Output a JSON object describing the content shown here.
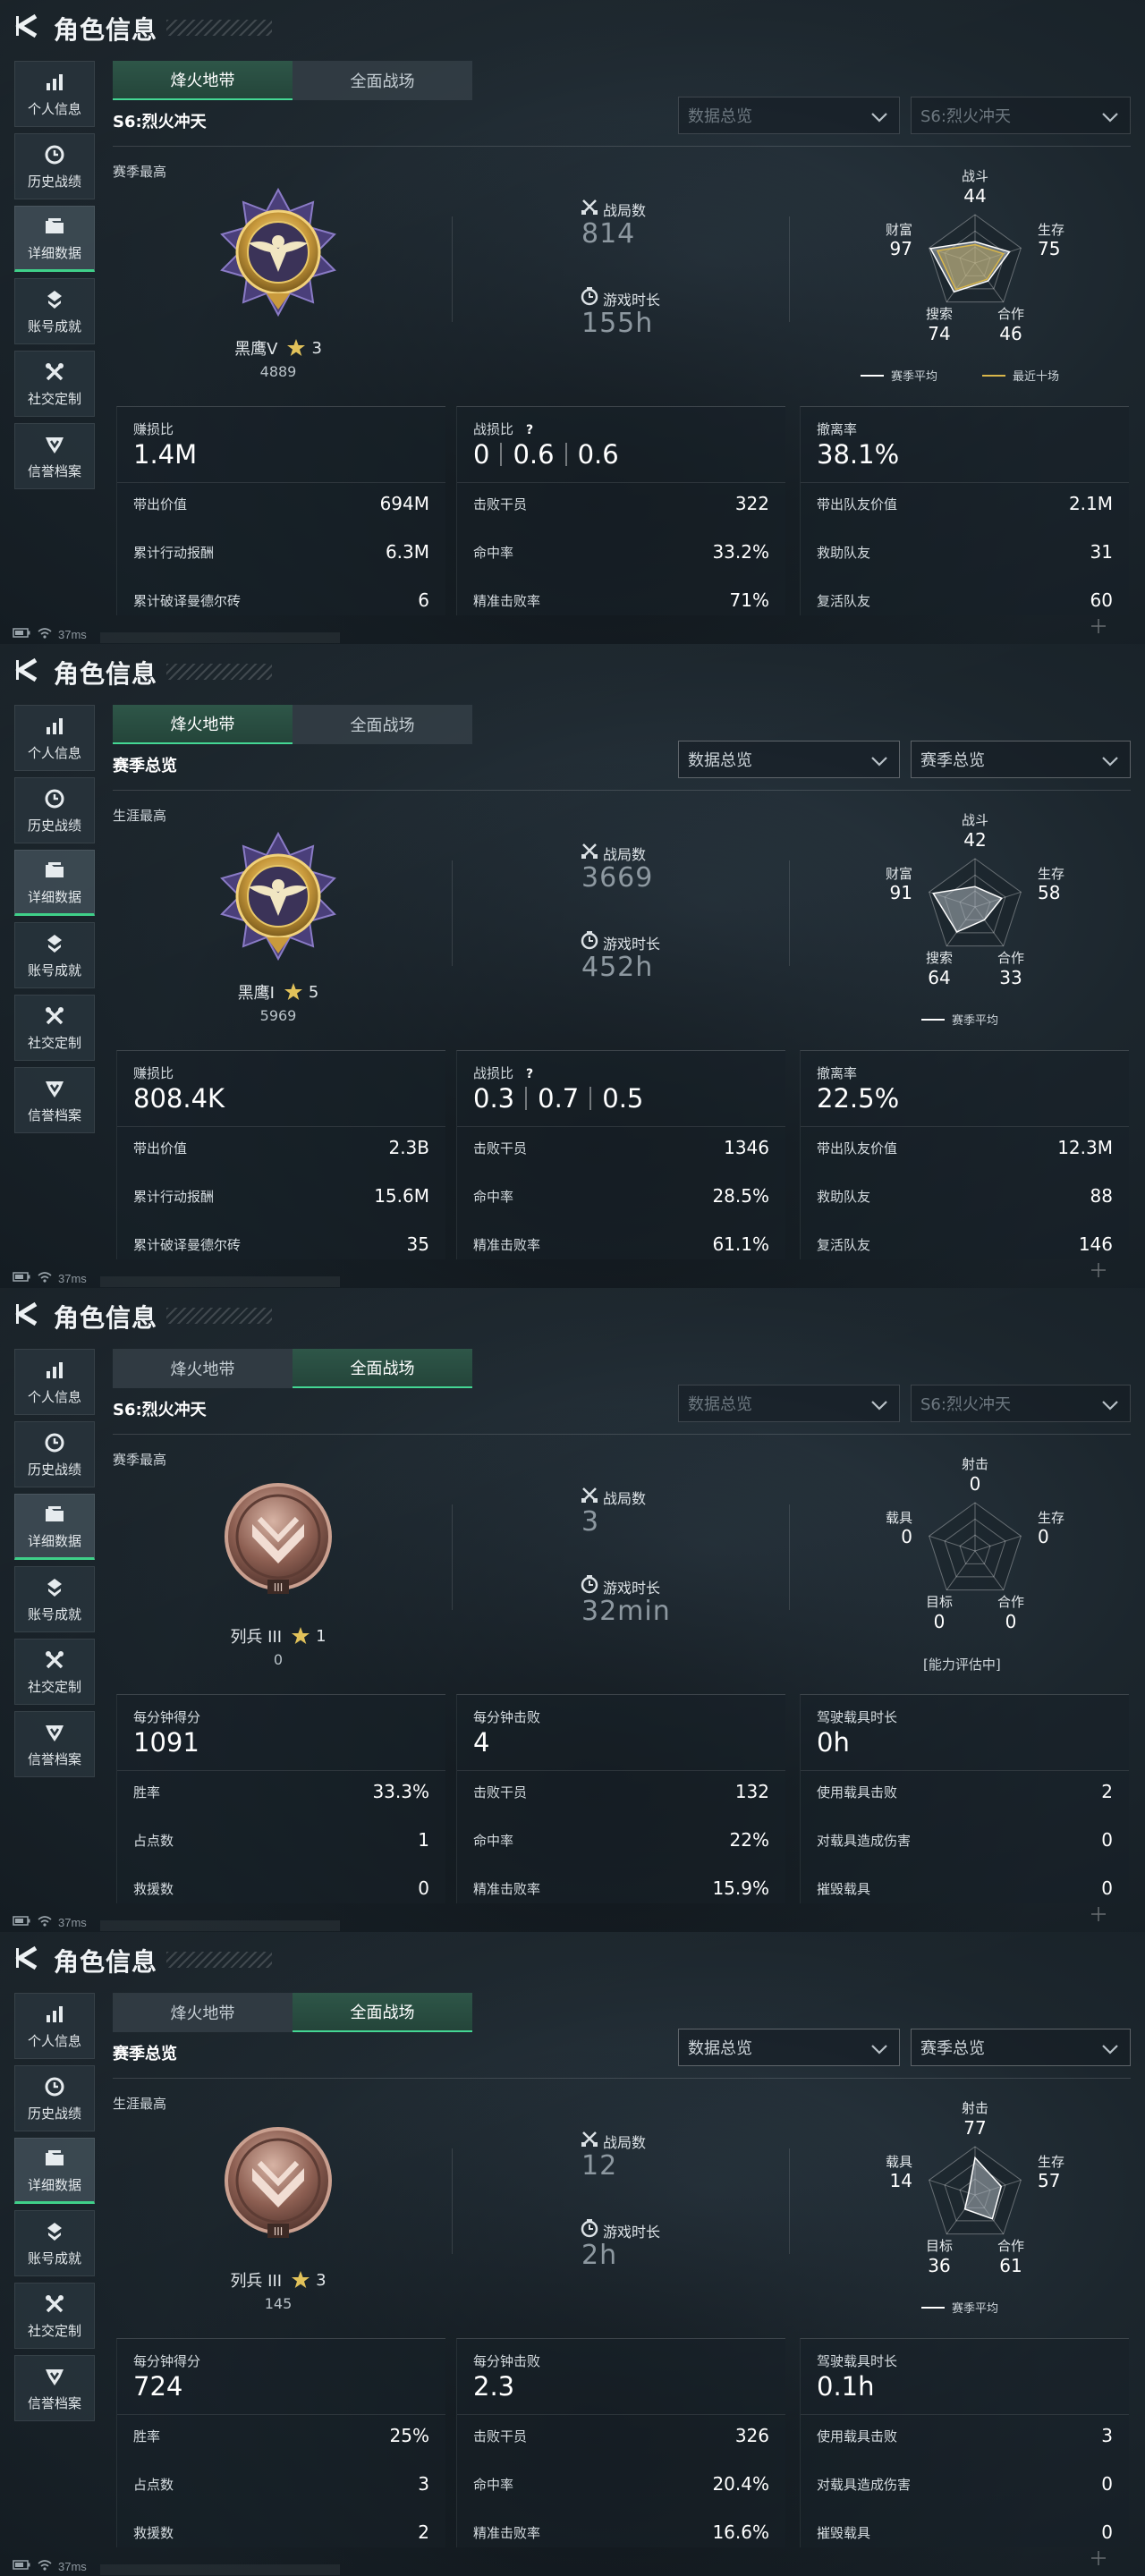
{
  "colors": {
    "accent_green": "#3fd089",
    "season_avg_line": "#ffffff",
    "recent_ten_line": "#d9b64a"
  },
  "panels": [
    {
      "title": "角色信息",
      "sidebar": [
        {
          "label": "个人信息",
          "icon": "bar-chart-icon"
        },
        {
          "label": "历史战绩",
          "icon": "clock-icon"
        },
        {
          "label": "详细数据",
          "icon": "folder-icon",
          "active": true
        },
        {
          "label": "账号成就",
          "icon": "achievement-icon"
        },
        {
          "label": "社交定制",
          "icon": "tools-icon"
        },
        {
          "label": "信誉档案",
          "icon": "shield-icon"
        }
      ],
      "tabs": [
        {
          "label": "烽火地带",
          "active": true
        },
        {
          "label": "全面战场",
          "active": false
        }
      ],
      "season_title": "S6:烈火冲天",
      "dropdown1": "数据总览",
      "dropdown2": "S6:烈火冲天",
      "dropdowns_dim": true,
      "best_label": "赛季最高",
      "rank": {
        "name": "黑鹰V",
        "stars": "3",
        "score": "4889",
        "badge": "eagle-badge"
      },
      "matches_label": "战局数",
      "matches": "814",
      "time_label": "游戏时长",
      "time": "155h",
      "radar": {
        "labels": [
          "战斗",
          "生存",
          "合作",
          "搜索",
          "财富"
        ],
        "values": [
          "44",
          "75",
          "46",
          "74",
          "97"
        ],
        "season_avg": [
          0.44,
          0.75,
          0.46,
          0.74,
          0.97
        ],
        "recent_ten": [
          0.38,
          0.62,
          0.42,
          0.68,
          0.82
        ],
        "legend": [
          "赛季平均",
          "最近十场"
        ],
        "unknown": false
      },
      "cards": [
        {
          "head_label": "赚损比",
          "head_value": "1.4M",
          "rows": [
            {
              "label": "带出价值",
              "value": "694M"
            },
            {
              "label": "累计行动报酬",
              "value": "6.3M"
            },
            {
              "label": "累计破译曼德尔砖",
              "value": "6"
            }
          ]
        },
        {
          "head_label": "战损比",
          "ratios": [
            "0",
            "0.6",
            "0.6"
          ],
          "rows": [
            {
              "label": "击败干员",
              "value": "322"
            },
            {
              "label": "命中率",
              "value": "33.2%"
            },
            {
              "label": "精准击败率",
              "value": "71%"
            }
          ]
        },
        {
          "head_label": "撤离率",
          "head_value": "38.1%",
          "rows": [
            {
              "label": "带出队友价值",
              "value": "2.1M"
            },
            {
              "label": "救助队友",
              "value": "31"
            },
            {
              "label": "复活队友",
              "value": "60"
            }
          ]
        }
      ],
      "status_ping": "37ms"
    },
    {
      "title": "角色信息",
      "sidebar": [
        {
          "label": "个人信息",
          "icon": "bar-chart-icon"
        },
        {
          "label": "历史战绩",
          "icon": "clock-icon"
        },
        {
          "label": "详细数据",
          "icon": "folder-icon",
          "active": true
        },
        {
          "label": "账号成就",
          "icon": "achievement-icon"
        },
        {
          "label": "社交定制",
          "icon": "tools-icon"
        },
        {
          "label": "信誉档案",
          "icon": "shield-icon"
        }
      ],
      "tabs": [
        {
          "label": "烽火地带",
          "active": true
        },
        {
          "label": "全面战场",
          "active": false
        }
      ],
      "season_title": "赛季总览",
      "dropdown1": "数据总览",
      "dropdown2": "赛季总览",
      "dropdowns_dim": false,
      "best_label": "生涯最高",
      "rank": {
        "name": "黑鹰I",
        "stars": "5",
        "score": "5969",
        "badge": "eagle-badge"
      },
      "matches_label": "战局数",
      "matches": "3669",
      "time_label": "游戏时长",
      "time": "452h",
      "radar": {
        "labels": [
          "战斗",
          "生存",
          "合作",
          "搜索",
          "财富"
        ],
        "values": [
          "42",
          "58",
          "33",
          "64",
          "91"
        ],
        "season_avg": [
          0.42,
          0.58,
          0.33,
          0.64,
          0.91
        ],
        "legend": [
          "赛季平均"
        ],
        "unknown": false
      },
      "cards": [
        {
          "head_label": "赚损比",
          "head_value": "808.4K",
          "rows": [
            {
              "label": "带出价值",
              "value": "2.3B"
            },
            {
              "label": "累计行动报酬",
              "value": "15.6M"
            },
            {
              "label": "累计破译曼德尔砖",
              "value": "35"
            }
          ]
        },
        {
          "head_label": "战损比",
          "ratios": [
            "0.3",
            "0.7",
            "0.5"
          ],
          "rows": [
            {
              "label": "击败干员",
              "value": "1346"
            },
            {
              "label": "命中率",
              "value": "28.5%"
            },
            {
              "label": "精准击败率",
              "value": "61.1%"
            }
          ]
        },
        {
          "head_label": "撤离率",
          "head_value": "22.5%",
          "rows": [
            {
              "label": "带出队友价值",
              "value": "12.3M"
            },
            {
              "label": "救助队友",
              "value": "88"
            },
            {
              "label": "复活队友",
              "value": "146"
            }
          ]
        }
      ],
      "status_ping": "37ms"
    },
    {
      "title": "角色信息",
      "sidebar": [
        {
          "label": "个人信息",
          "icon": "bar-chart-icon"
        },
        {
          "label": "历史战绩",
          "icon": "clock-icon"
        },
        {
          "label": "详细数据",
          "icon": "folder-icon",
          "active": true
        },
        {
          "label": "账号成就",
          "icon": "achievement-icon"
        },
        {
          "label": "社交定制",
          "icon": "tools-icon"
        },
        {
          "label": "信誉档案",
          "icon": "shield-icon"
        }
      ],
      "tabs": [
        {
          "label": "烽火地带",
          "active": false
        },
        {
          "label": "全面战场",
          "active": true
        }
      ],
      "season_title": "S6:烈火冲天",
      "dropdown1": "数据总览",
      "dropdown2": "S6:烈火冲天",
      "dropdowns_dim": true,
      "best_label": "赛季最高",
      "rank": {
        "name": "列兵 III",
        "stars": "1",
        "score": "0",
        "badge": "private-badge"
      },
      "matches_label": "战局数",
      "matches": "3",
      "time_label": "游戏时长",
      "time": "32min",
      "radar": {
        "labels": [
          "射击",
          "生存",
          "合作",
          "目标",
          "载具"
        ],
        "values": [
          "0",
          "0",
          "0",
          "0",
          "0"
        ],
        "season_avg": [
          0,
          0,
          0,
          0,
          0
        ],
        "legend": [
          "[能力评估中]"
        ],
        "unknown": true,
        "unknown_mark": "?"
      },
      "cards": [
        {
          "head_label": "每分钟得分",
          "head_value": "1091",
          "rows": [
            {
              "label": "胜率",
              "value": "33.3%"
            },
            {
              "label": "占点数",
              "value": "1"
            },
            {
              "label": "救援数",
              "value": "0"
            }
          ]
        },
        {
          "head_label": "每分钟击败",
          "head_value": "4",
          "rows": [
            {
              "label": "击败干员",
              "value": "132"
            },
            {
              "label": "命中率",
              "value": "22%"
            },
            {
              "label": "精准击败率",
              "value": "15.9%"
            }
          ]
        },
        {
          "head_label": "驾驶载具时长",
          "head_value": "0h",
          "rows": [
            {
              "label": "使用载具击败",
              "value": "2"
            },
            {
              "label": "对载具造成伤害",
              "value": "0"
            },
            {
              "label": "摧毁载具",
              "value": "0"
            }
          ]
        }
      ],
      "status_ping": "37ms"
    },
    {
      "title": "角色信息",
      "sidebar": [
        {
          "label": "个人信息",
          "icon": "bar-chart-icon"
        },
        {
          "label": "历史战绩",
          "icon": "clock-icon"
        },
        {
          "label": "详细数据",
          "icon": "folder-icon",
          "active": true
        },
        {
          "label": "账号成就",
          "icon": "achievement-icon"
        },
        {
          "label": "社交定制",
          "icon": "tools-icon"
        },
        {
          "label": "信誉档案",
          "icon": "shield-icon"
        }
      ],
      "tabs": [
        {
          "label": "烽火地带",
          "active": false
        },
        {
          "label": "全面战场",
          "active": true
        }
      ],
      "season_title": "赛季总览",
      "dropdown1": "数据总览",
      "dropdown2": "赛季总览",
      "dropdowns_dim": false,
      "best_label": "生涯最高",
      "rank": {
        "name": "列兵 III",
        "stars": "3",
        "score": "145",
        "badge": "private-badge"
      },
      "matches_label": "战局数",
      "matches": "12",
      "time_label": "游戏时长",
      "time": "2h",
      "radar": {
        "labels": [
          "射击",
          "生存",
          "合作",
          "目标",
          "载具"
        ],
        "values": [
          "77",
          "57",
          "61",
          "36",
          "14"
        ],
        "season_avg": [
          0.77,
          0.57,
          0.61,
          0.36,
          0.14
        ],
        "legend": [
          "赛季平均"
        ],
        "unknown": false
      },
      "cards": [
        {
          "head_label": "每分钟得分",
          "head_value": "724",
          "rows": [
            {
              "label": "胜率",
              "value": "25%"
            },
            {
              "label": "占点数",
              "value": "3"
            },
            {
              "label": "救援数",
              "value": "2"
            }
          ]
        },
        {
          "head_label": "每分钟击败",
          "head_value": "2.3",
          "rows": [
            {
              "label": "击败干员",
              "value": "326"
            },
            {
              "label": "命中率",
              "value": "20.4%"
            },
            {
              "label": "精准击败率",
              "value": "16.6%"
            }
          ]
        },
        {
          "head_label": "驾驶载具时长",
          "head_value": "0.1h",
          "rows": [
            {
              "label": "使用载具击败",
              "value": "3"
            },
            {
              "label": "对载具造成伤害",
              "value": "0"
            },
            {
              "label": "摧毁载具",
              "value": "0"
            }
          ]
        }
      ],
      "status_ping": "37ms"
    }
  ]
}
